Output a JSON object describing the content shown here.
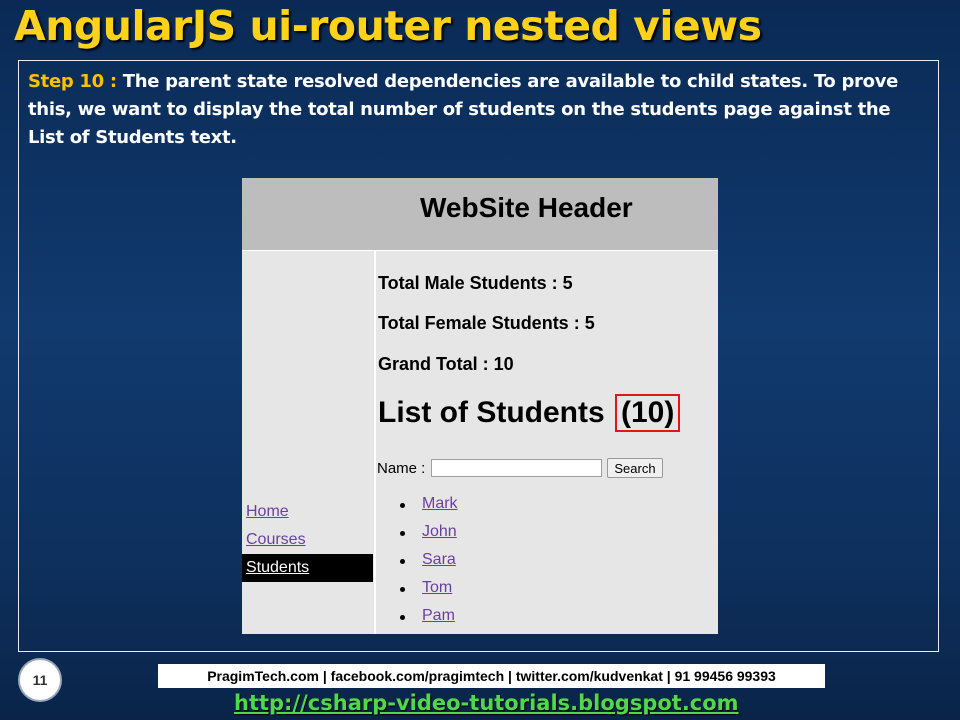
{
  "slide": {
    "title": "AngularJS ui-router nested views",
    "step_label": "Step 10 :",
    "step_text": " The parent state resolved dependencies are available to child states. To prove this, we want to display the total number of students on the students page against the List of Students text.",
    "page_number": "11"
  },
  "demo": {
    "header": "WebSite Header",
    "nav": [
      {
        "label": "Home"
      },
      {
        "label": "Courses"
      },
      {
        "label": "Students"
      }
    ],
    "stats": {
      "male": "Total Male Students : 5",
      "female": "Total Female Students : 5",
      "grand": "Grand Total : 10"
    },
    "list_title": "List of Students",
    "list_count": "(10)",
    "search": {
      "label": "Name :",
      "value": "",
      "button": "Search"
    },
    "students": [
      "Mark",
      "John",
      "Sara",
      "Tom",
      "Pam"
    ]
  },
  "footer": {
    "contacts": "PragimTech.com | facebook.com/pragimtech  | twitter.com/kudvenkat  | 91 99456 99393",
    "url": "http://csharp-video-tutorials.blogspot.com"
  },
  "colors": {
    "title": "#ffd21a",
    "step_label": "#ffc000",
    "highlight_box": "#e0161d",
    "link": "#6b3fa0",
    "url": "#4fd84a"
  }
}
